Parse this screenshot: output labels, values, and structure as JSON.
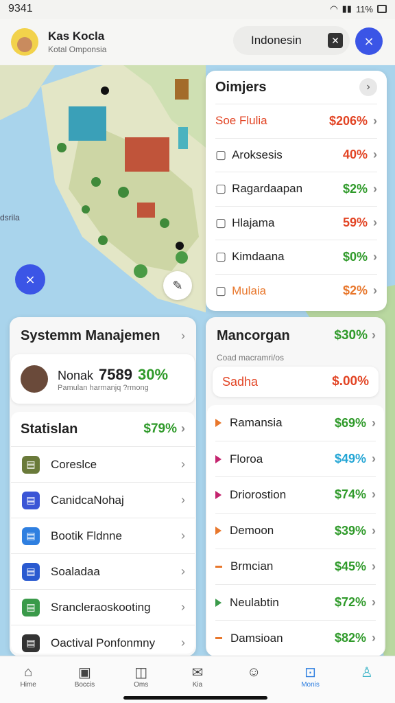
{
  "status": {
    "time": "9341",
    "battery": "11%"
  },
  "header": {
    "name": "Kas Kocla",
    "subtitle": "Kotal Omponsia",
    "search_value": "Indonesin",
    "close_glyph": "✕"
  },
  "map": {
    "label": "dsrila"
  },
  "orders": {
    "title": "Oimjers",
    "items": [
      {
        "label": "Soe Flulia",
        "value": "$206%",
        "color": "#e24424",
        "icon": "none"
      },
      {
        "label": "Aroksesis",
        "value": "40%",
        "color": "#e24424",
        "icon": "pencil-icon"
      },
      {
        "label": "Ragardaapan",
        "value": "$2%",
        "color": "#2f9a2a",
        "icon": "mountain-icon"
      },
      {
        "label": "Hlajama",
        "value": "59%",
        "color": "#e24424",
        "icon": "box-icon"
      },
      {
        "label": "Kimdaana",
        "value": "$0%",
        "color": "#2f9a2a",
        "icon": "shoe-icon"
      },
      {
        "label": "Mulaia",
        "value": "$2%",
        "color": "#e8772c",
        "icon": "table-icon"
      }
    ]
  },
  "system": {
    "title": "Systemm Manajemen",
    "profile": {
      "name": "Nonak",
      "number": "7589",
      "pct": "30%",
      "sub": "Pamulan harmanjq ?rmong"
    },
    "stats_title": "Statislan",
    "stats_value": "$79%",
    "items": [
      {
        "label": "Coreslce",
        "icon": "stack-icon",
        "color": "#6a7a3a"
      },
      {
        "label": "CanidcaNohaj",
        "icon": "id-card-icon",
        "color": "#3b55d6"
      },
      {
        "label": "Bootik Fldnne",
        "icon": "book-icon",
        "color": "#2f7fe0"
      },
      {
        "label": "Soaladaa",
        "icon": "document-icon",
        "color": "#2a5ad0"
      },
      {
        "label": "Srancleraoskooting",
        "icon": "checklist-icon",
        "color": "#3a9a4a"
      },
      {
        "label": "Oactival Ponfonmny",
        "icon": "clipboard-icon",
        "color": "#333333"
      }
    ]
  },
  "manager": {
    "title": "Mancorgan",
    "value": "$30%",
    "sub": "Coad macramri/os",
    "highlight": {
      "label": "Sadha",
      "value": "$.00%"
    },
    "items": [
      {
        "label": "Ramansia",
        "value": "$69%",
        "mark": "#e8772c",
        "color": "#2f9a2a"
      },
      {
        "label": "Floroa",
        "value": "$49%",
        "mark": "#c4246e",
        "color": "#25a6d5"
      },
      {
        "label": "Driorostion",
        "value": "$74%",
        "mark": "#c4246e",
        "color": "#2f9a2a"
      },
      {
        "label": "Demoon",
        "value": "$39%",
        "mark": "#e8772c",
        "color": "#2f9a2a"
      },
      {
        "label": "Brmcian",
        "value": "$45%",
        "mark": "#e8772c",
        "color": "#2f9a2a"
      },
      {
        "label": "Neulabtin",
        "value": "$72%",
        "mark": "#3a9a4a",
        "color": "#2f9a2a"
      },
      {
        "label": "Damsioan",
        "value": "$82%",
        "mark": "#e8772c",
        "color": "#2f9a2a"
      }
    ]
  },
  "tabs": [
    {
      "label": "Hime",
      "icon": "home-icon"
    },
    {
      "label": "Boccis",
      "icon": "calendar-icon"
    },
    {
      "label": "Oms",
      "icon": "cube-icon"
    },
    {
      "label": "Kia",
      "icon": "mail-icon"
    },
    {
      "label": "",
      "icon": "face-icon"
    },
    {
      "label": "Monis",
      "icon": "bag-icon",
      "active": true
    },
    {
      "label": "",
      "icon": "person-icon"
    }
  ]
}
